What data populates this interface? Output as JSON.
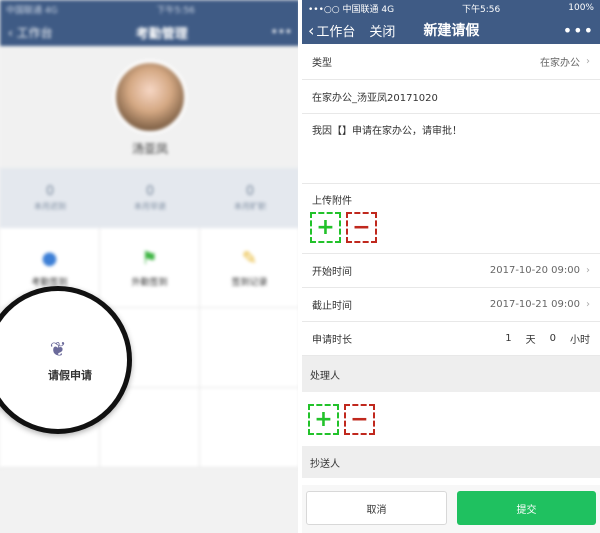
{
  "left": {
    "status": {
      "carrier": "中国联通 4G",
      "time": "下午5:56"
    },
    "nav": {
      "back": "工作台",
      "title": "考勤管理",
      "more": "•••"
    },
    "profile": {
      "name": "汤亚凤"
    },
    "stats": [
      {
        "value": "0",
        "label": "本月迟到"
      },
      {
        "value": "0",
        "label": "本月早退"
      },
      {
        "value": "0",
        "label": "本月旷职"
      }
    ],
    "grid": [
      {
        "icon": "location-icon",
        "label": "考勤签到"
      },
      {
        "icon": "flag-icon",
        "label": "外勤签到"
      },
      {
        "icon": "pencil-icon",
        "label": "签到记录"
      }
    ],
    "magnified": {
      "icon": "leaf-icon",
      "label": "请假申请"
    }
  },
  "right": {
    "status": {
      "carrier": "•••○○ 中国联通  4G",
      "time": "下午5:56",
      "battery": "100%"
    },
    "nav": {
      "back": "工作台",
      "close": "关闭",
      "title": "新建请假",
      "more": "•••"
    },
    "type_row": {
      "label": "类型",
      "value": "在家办公"
    },
    "title_text": "在家办公_汤亚凤20171020",
    "reason_text": "我因【】申请在家办公，请审批！",
    "upload_label": "上传附件",
    "start": {
      "label": "开始时间",
      "value": "2017-10-20 09:00"
    },
    "end": {
      "label": "截止时间",
      "value": "2017-10-21 09:00"
    },
    "duration": {
      "label": "申请时长",
      "days": "1",
      "day_unit": "天",
      "hours": "0",
      "hour_unit": "小时"
    },
    "handler_label": "处理人",
    "cc_label": "抄送人",
    "cancel_label": "取消",
    "submit_label": "提交",
    "accent_color": "#1fc160",
    "nav_color": "#3f5b85"
  }
}
